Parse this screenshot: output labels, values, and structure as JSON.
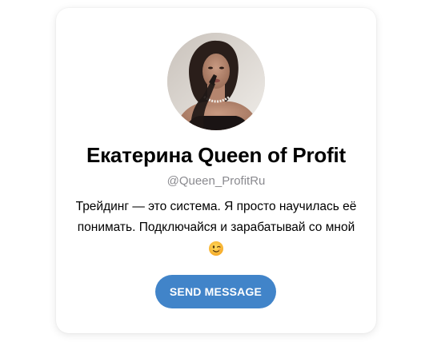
{
  "profile": {
    "name": "Екатерина Queen of Profit",
    "username": "@Queen_ProfitRu",
    "bio_lines": [
      "Трейдинг — это система. Я просто научилась её",
      "понимать. Подключайся и зарабатывай со мной"
    ],
    "bio_emoji": "winking-face-emoji"
  },
  "actions": {
    "send_label": "SEND MESSAGE"
  },
  "colors": {
    "button": "#4184c9",
    "username": "#8a8a8f",
    "card_background": "#ffffff"
  }
}
